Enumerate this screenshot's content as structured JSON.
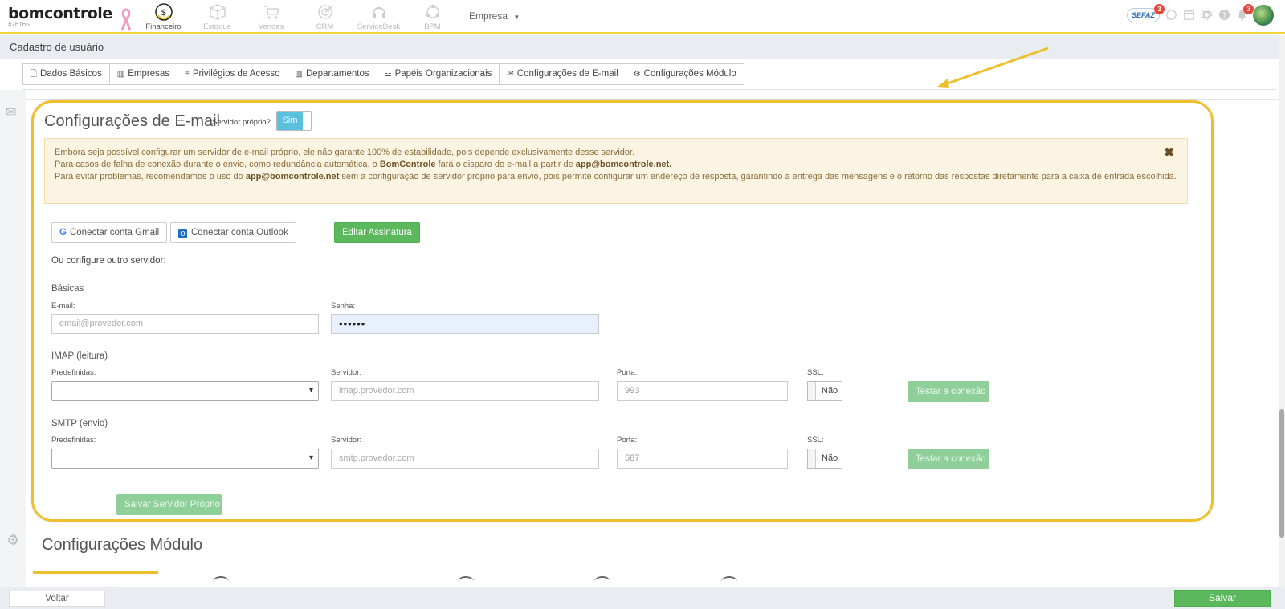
{
  "app": {
    "logo": "bomcontrole",
    "account_id": "#76165",
    "modules": [
      {
        "label": "Financeiro",
        "icon": "dollar-coin-icon",
        "active": true
      },
      {
        "label": "Estoque",
        "icon": "box-icon",
        "active": false
      },
      {
        "label": "Vendas",
        "icon": "cart-icon",
        "active": false
      },
      {
        "label": "CRM",
        "icon": "target-icon",
        "active": false
      },
      {
        "label": "ServiceDesk",
        "icon": "headset-icon",
        "active": false
      },
      {
        "label": "BPM",
        "icon": "process-icon",
        "active": false
      }
    ],
    "empresa": "Empresa",
    "sefaz": {
      "label": "SEFAZ",
      "badge": "3"
    },
    "notifications_badge": "3"
  },
  "page": {
    "title": "Cadastro de usuário"
  },
  "tabs": [
    {
      "label": "Dados Básicos",
      "icon": "file-icon"
    },
    {
      "label": "Empresas",
      "icon": "building-icon"
    },
    {
      "label": "Privilégios de Acesso",
      "icon": "list-icon"
    },
    {
      "label": "Departamentos",
      "icon": "building-icon"
    },
    {
      "label": "Papéis Organizacionais",
      "icon": "sitemap-icon"
    },
    {
      "label": "Configurações de E-mail",
      "icon": "envelope-icon"
    },
    {
      "label": "Configurações Módulo",
      "icon": "gear-icon"
    }
  ],
  "email_config": {
    "title": "Configurações de E-mail",
    "own_server_label": "Servidor próprio?",
    "own_server_value": "Sim",
    "alert": {
      "line1": "Embora seja possível configurar um servidor de e-mail próprio, ele não garante 100% de estabilidade, pois depende exclusivamente desse servidor.",
      "line2_a": "Para casos de falha de conexão durante o envio, como redundância automática, o ",
      "line2_b": "BomControle",
      "line2_c": " fará o disparo do e-mail a partir de ",
      "line2_d": "app@bomcontrole.net.",
      "line3_a": "Para evitar problemas, recomendamos o uso do ",
      "line3_b": "app@bomcontrole.net",
      "line3_c": " sem a configuração de servidor próprio para envio, pois permite configurar um endereço de resposta, garantindo a entrega das mensagens e o retorno das respostas diretamente para a caixa de entrada escolhida."
    },
    "btn_gmail": "Conectar conta Gmail",
    "btn_outlook": "Conectar conta Outlook",
    "btn_signature": "Editar Assinatura",
    "other_server": "Ou configure outro servidor:",
    "basic": {
      "title": "Básicas",
      "email_label": "E-mail:",
      "email_placeholder": "email@provedor.com",
      "password_label": "Senha:",
      "password_value": "••••••"
    },
    "imap": {
      "title": "IMAP (leitura)",
      "preset_label": "Predefinidas:",
      "server_label": "Servidor:",
      "server_placeholder": "imap.provedor.com",
      "port_label": "Porta:",
      "port_value": "993",
      "ssl_label": "SSL:",
      "ssl_value": "Não",
      "test_button": "Testar a conexão"
    },
    "smtp": {
      "title": "SMTP (envio)",
      "preset_label": "Predefinidas:",
      "server_label": "Servidor:",
      "server_placeholder": "smtp.provedor.com",
      "port_label": "Porta:",
      "port_value": "587",
      "ssl_label": "SSL:",
      "ssl_value": "Não",
      "test_button": "Testar a conexão"
    },
    "save_own_server": "Salvar Servidor Próprio"
  },
  "module_config": {
    "title": "Configurações Módulo"
  },
  "footer": {
    "back": "Voltar",
    "save": "Salvar"
  },
  "colors": {
    "highlight": "#efbf2b",
    "success": "#5cb85c",
    "toggle_on": "#5bc0de",
    "alert_bg": "#fcf4e3"
  }
}
